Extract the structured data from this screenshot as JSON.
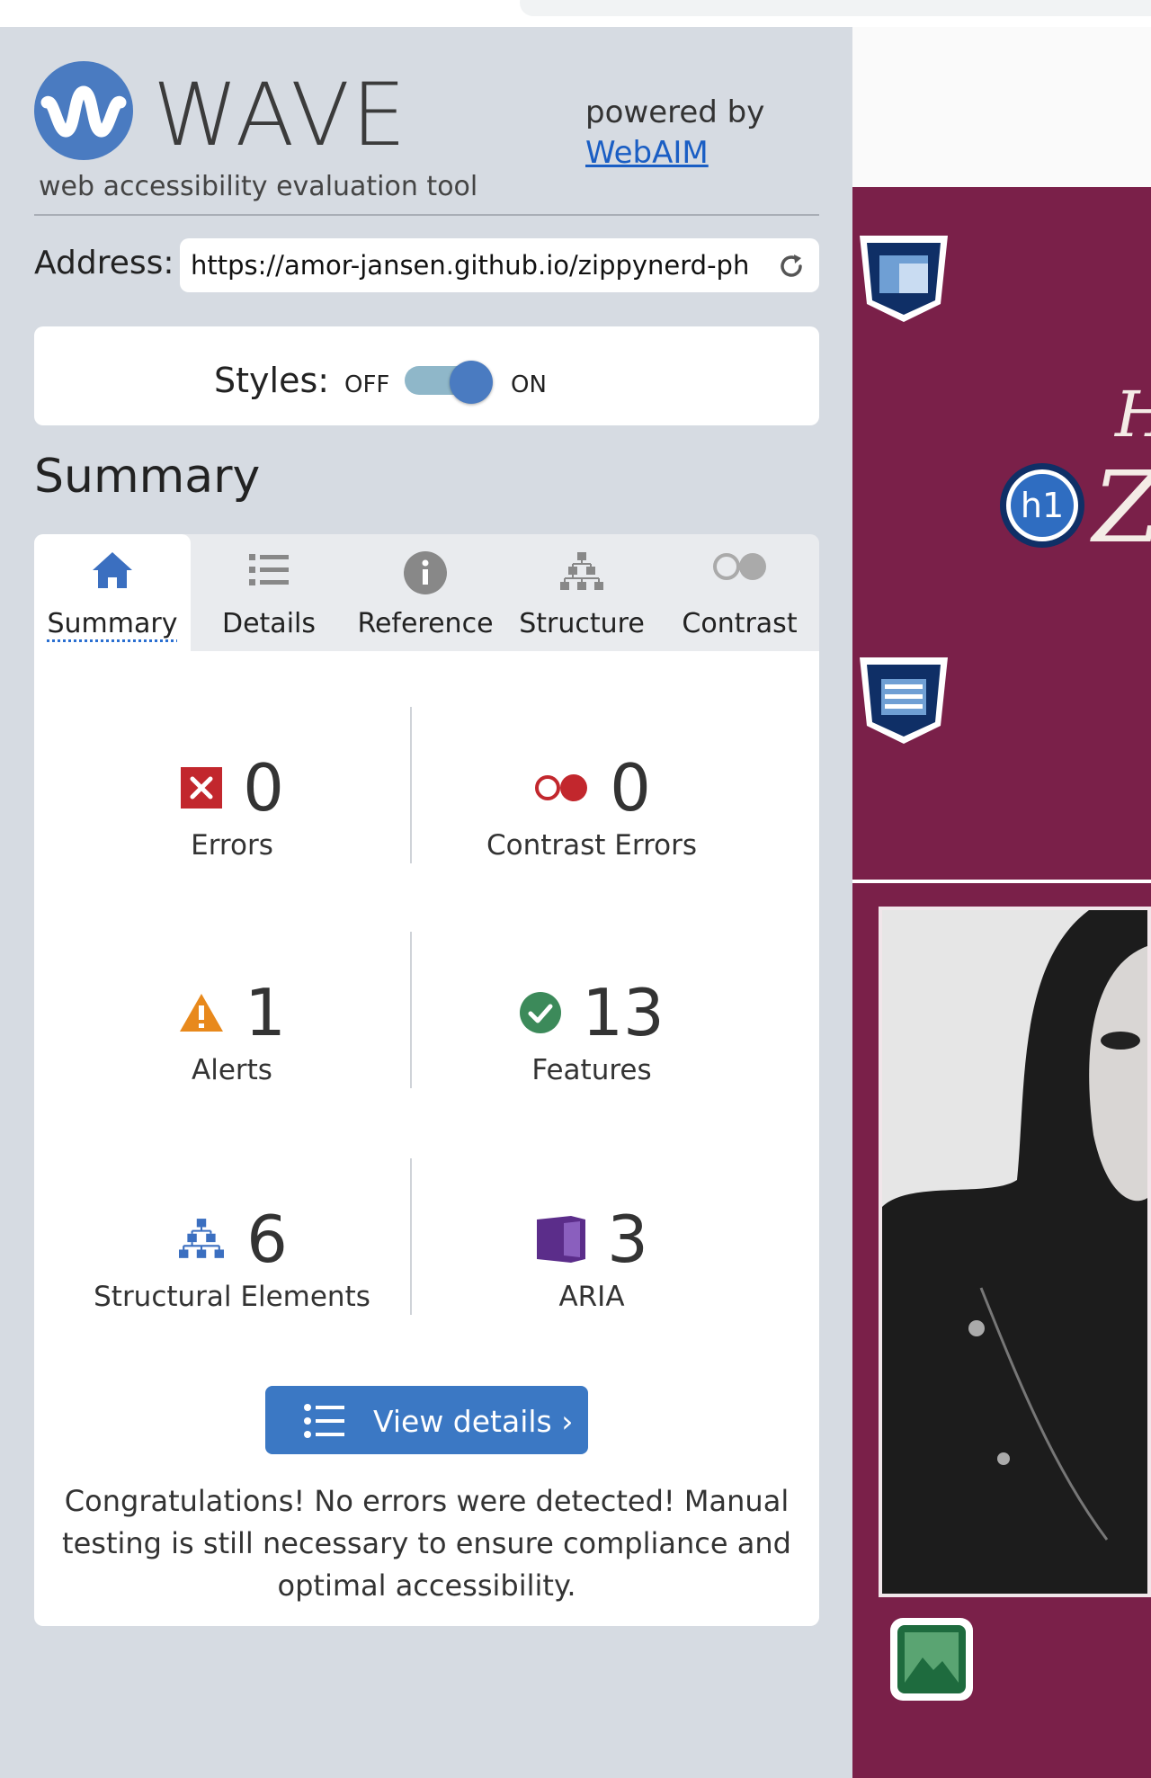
{
  "header": {
    "app_name": "WAVE",
    "subtitle": "web accessibility evaluation tool",
    "powered_by": "powered by",
    "powered_link": "WebAIM"
  },
  "address": {
    "label": "Address:",
    "value": "https://amor-jansen.github.io/zippynerd-ph"
  },
  "styles": {
    "label": "Styles:",
    "off": "OFF",
    "on": "ON",
    "state": "on"
  },
  "summary": {
    "heading": "Summary"
  },
  "tabs": [
    {
      "label": "Summary",
      "icon": "home-icon",
      "active": true
    },
    {
      "label": "Details",
      "icon": "list-icon",
      "active": false
    },
    {
      "label": "Reference",
      "icon": "info-icon",
      "active": false
    },
    {
      "label": "Structure",
      "icon": "hierarchy-icon",
      "active": false
    },
    {
      "label": "Contrast",
      "icon": "contrast-icon",
      "active": false
    }
  ],
  "stats": {
    "errors": {
      "count": "0",
      "label": "Errors",
      "icon": "error-icon",
      "color": "#c2272d"
    },
    "contrast_errors": {
      "count": "0",
      "label": "Contrast Errors",
      "icon": "contrast-error-icon",
      "color": "#c2272d"
    },
    "alerts": {
      "count": "1",
      "label": "Alerts",
      "icon": "warning-icon",
      "color": "#e8891c"
    },
    "features": {
      "count": "13",
      "label": "Features",
      "icon": "checkmark-icon",
      "color": "#3c8a5a"
    },
    "structural": {
      "count": "6",
      "label": "Structural Elements",
      "icon": "hierarchy-icon",
      "color": "#3b6fc0"
    },
    "aria": {
      "count": "3",
      "label": "ARIA",
      "icon": "aria-icon",
      "color": "#5b2d8a"
    }
  },
  "actions": {
    "view_details": "View details ›"
  },
  "message": "Congratulations! No errors were detected! Manual testing is still necessary to ensure compliance and optimal accessibility.",
  "evaluated_page": {
    "badge_h1": "h1",
    "hero_color": "#7a2049",
    "overlay_icons": [
      "header-region-icon",
      "h1-badge-icon",
      "nav-region-icon",
      "image-feature-icon"
    ]
  }
}
